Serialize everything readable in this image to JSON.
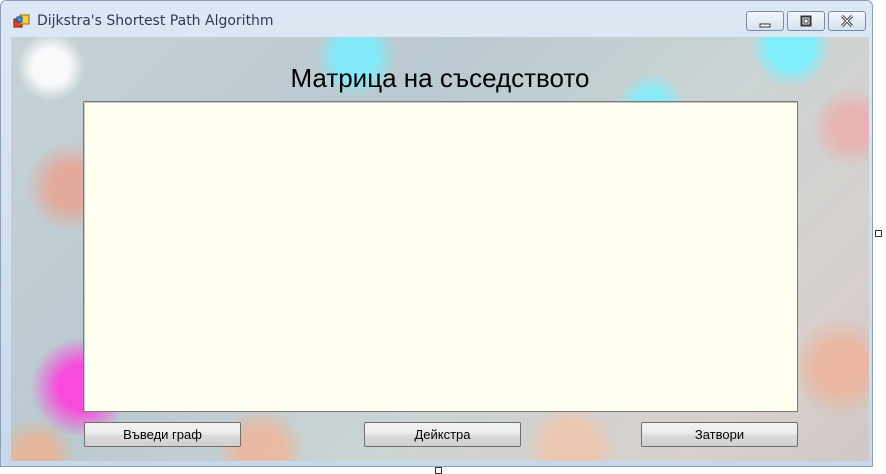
{
  "window": {
    "title": "Dijkstra's Shortest Path Algorithm"
  },
  "main": {
    "heading": "Матрица на съседството",
    "matrix_text": ""
  },
  "buttons": {
    "input_graph": "Въведи граф",
    "dijkstra": "Дейкстра",
    "close": "Затвори"
  }
}
